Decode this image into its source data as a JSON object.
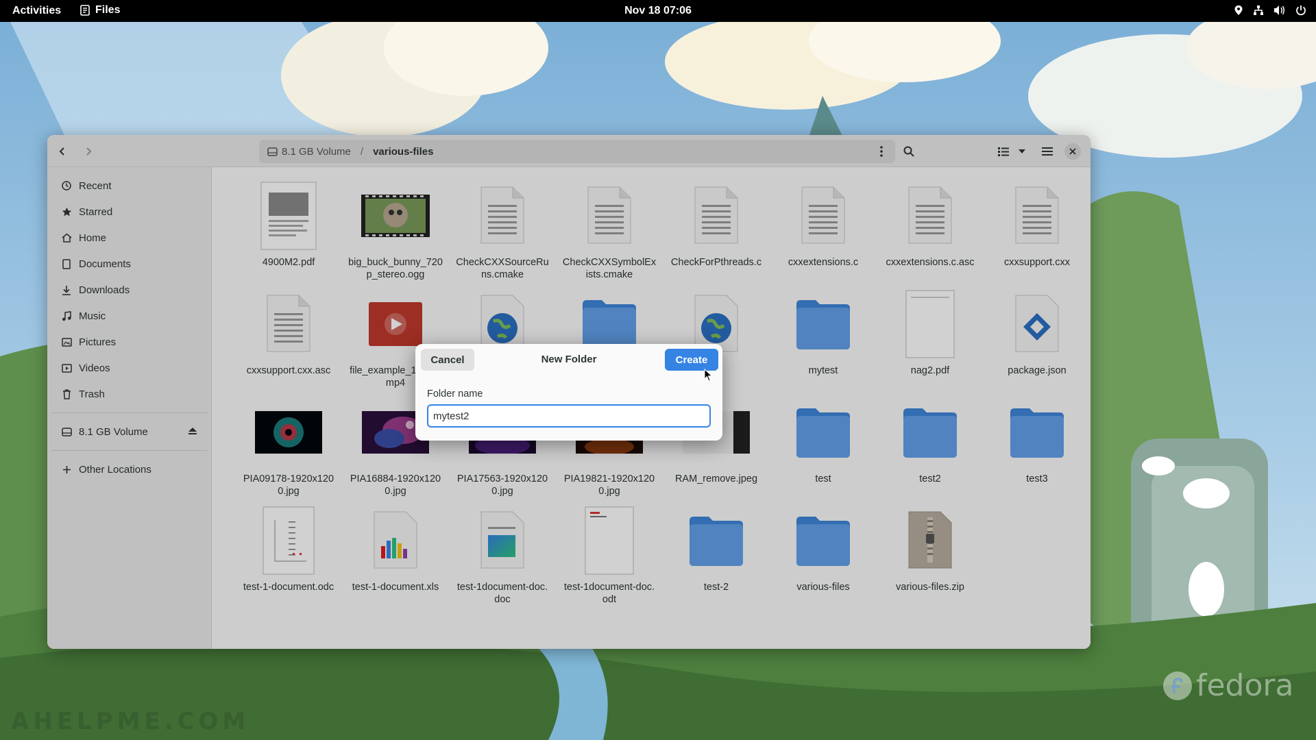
{
  "topbar": {
    "activities": "Activities",
    "app_name": "Files",
    "clock": "Nov 18  07:06",
    "tray_icons": [
      "location-icon",
      "network-icon",
      "volume-icon",
      "power-icon"
    ]
  },
  "window": {
    "path": {
      "volume": "8.1 GB Volume",
      "current": "various-files"
    },
    "sidebar": {
      "places": [
        {
          "label": "Recent",
          "icon": "clock-icon"
        },
        {
          "label": "Starred",
          "icon": "star-icon"
        },
        {
          "label": "Home",
          "icon": "home-icon"
        },
        {
          "label": "Documents",
          "icon": "document-icon"
        },
        {
          "label": "Downloads",
          "icon": "download-icon"
        },
        {
          "label": "Music",
          "icon": "music-icon"
        },
        {
          "label": "Pictures",
          "icon": "pictures-icon"
        },
        {
          "label": "Videos",
          "icon": "videos-icon"
        },
        {
          "label": "Trash",
          "icon": "trash-icon"
        }
      ],
      "volume": "8.1 GB Volume",
      "other_locations": "Other Locations"
    },
    "files": [
      {
        "name": "4900M2.pdf",
        "type": "pdf"
      },
      {
        "name": "big_buck_bunny_720p_stereo.ogg",
        "type": "video-thumb"
      },
      {
        "name": "CheckCXXSourceRuns.cmake",
        "type": "text"
      },
      {
        "name": "CheckCXXSymbolExists.cmake",
        "type": "text"
      },
      {
        "name": "CheckForPthreads.c",
        "type": "text"
      },
      {
        "name": "cxxextensions.c",
        "type": "text"
      },
      {
        "name": "cxxextensions.c.asc",
        "type": "text"
      },
      {
        "name": "cxxsupport.cxx",
        "type": "text"
      },
      {
        "name": "cxxsupport.cxx.asc",
        "type": "text"
      },
      {
        "name": "file_example_1080p.mp4",
        "type": "video"
      },
      {
        "name": "",
        "type": "html"
      },
      {
        "name": "",
        "type": "folder"
      },
      {
        "name": "",
        "type": "html"
      },
      {
        "name": "mytest",
        "type": "folder"
      },
      {
        "name": "nag2.pdf",
        "type": "blank-pdf"
      },
      {
        "name": "package.json",
        "type": "json"
      },
      {
        "name": "PIA09178-1920x1200.jpg",
        "type": "image-nebula"
      },
      {
        "name": "PIA16884-1920x1200.jpg",
        "type": "image-space"
      },
      {
        "name": "PIA17563-1920x1200.jpg",
        "type": "image-purple"
      },
      {
        "name": "PIA19821-1920x1200.jpg",
        "type": "image-orange"
      },
      {
        "name": "RAM_remove.jpeg",
        "type": "image-dark"
      },
      {
        "name": "test",
        "type": "folder"
      },
      {
        "name": "test2",
        "type": "folder"
      },
      {
        "name": "test3",
        "type": "folder"
      },
      {
        "name": "test-1-document.odc",
        "type": "chart-doc"
      },
      {
        "name": "test-1-document.xls",
        "type": "spreadsheet"
      },
      {
        "name": "test-1document-doc.doc",
        "type": "doc"
      },
      {
        "name": "test-1document-doc.odt",
        "type": "odt"
      },
      {
        "name": "test-2",
        "type": "folder"
      },
      {
        "name": "various-files",
        "type": "folder"
      },
      {
        "name": "various-files.zip",
        "type": "zip"
      }
    ]
  },
  "dialog": {
    "title": "New Folder",
    "cancel": "Cancel",
    "create": "Create",
    "field_label": "Folder name",
    "field_value": "mytest2"
  },
  "watermark": "AHELPME.COM",
  "distro_logo": "fedora",
  "colors": {
    "accent": "#3584e4",
    "folder": "#62a0ea",
    "topbar": "#000000"
  }
}
